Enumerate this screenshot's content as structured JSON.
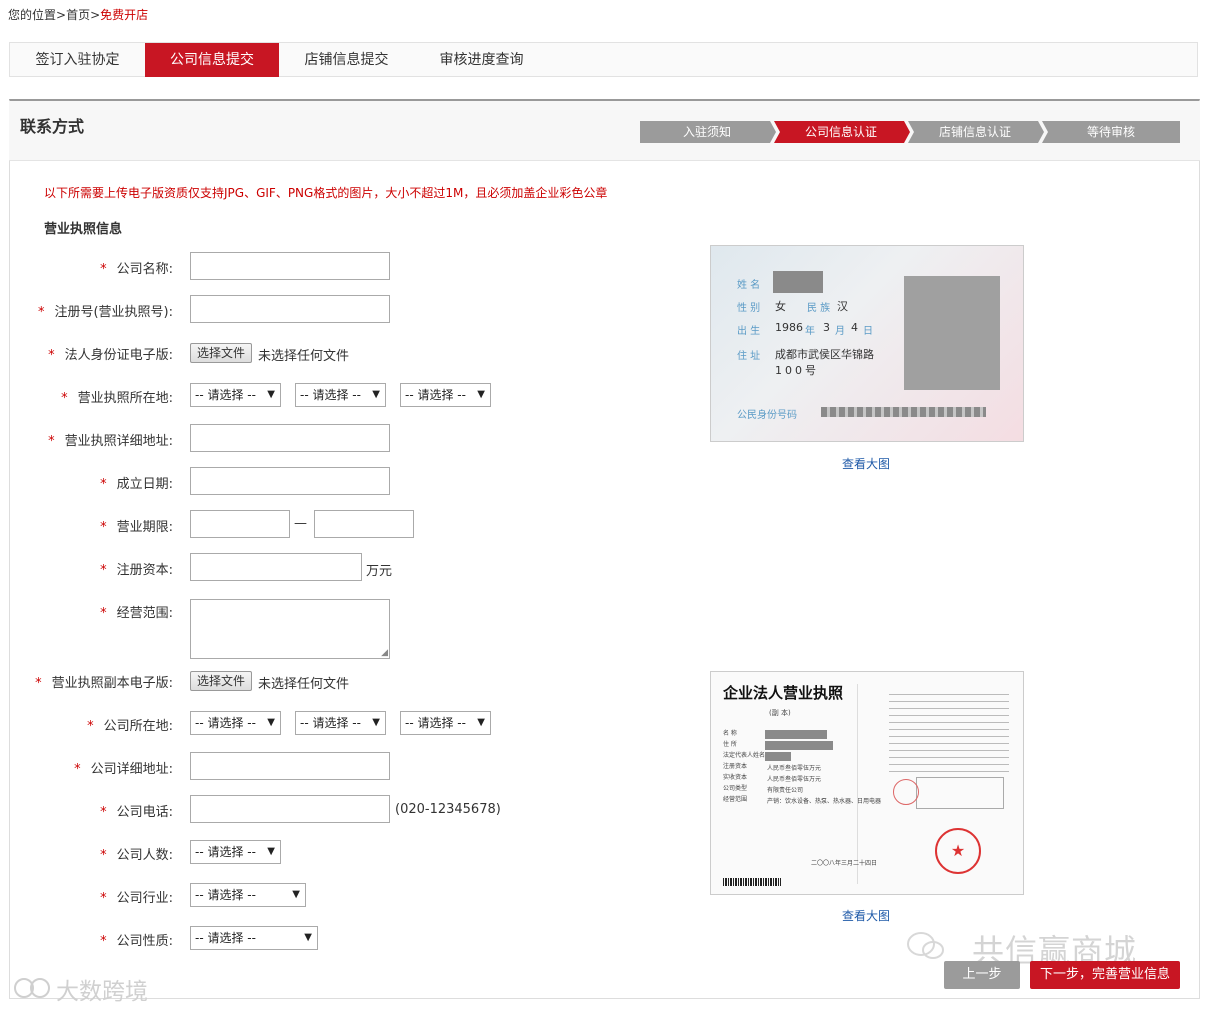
{
  "breadcrumb": {
    "prefix": "您的位置>",
    "home": "首页",
    "sep": ">",
    "current": "免费开店"
  },
  "tabs": [
    {
      "label": "签订入驻协定",
      "active": false
    },
    {
      "label": "公司信息提交",
      "active": true
    },
    {
      "label": "店铺信息提交",
      "active": false
    },
    {
      "label": "审核进度查询",
      "active": false
    }
  ],
  "panel": {
    "title": "联系方式"
  },
  "steps": [
    {
      "label": "入驻须知",
      "active": false
    },
    {
      "label": "公司信息认证",
      "active": true
    },
    {
      "label": "店铺信息认证",
      "active": false
    },
    {
      "label": "等待审核",
      "active": false
    }
  ],
  "notice": "以下所需要上传电子版资质仅支持JPG、GIF、PNG格式的图片，大小不超过1M，且必须加盖企业彩色公章",
  "section_title": "营业执照信息",
  "required_mark": "*",
  "fields": {
    "company_name": "公司名称:",
    "reg_no": "注册号(营业执照号):",
    "id_card": "法人身份证电子版:",
    "license_location": "营业执照所在地:",
    "license_address": "营业执照详细地址:",
    "founded": "成立日期:",
    "term": "营业期限:",
    "capital": "注册资本:",
    "scope": "经营范围:",
    "license_copy": "营业执照副本电子版:",
    "company_location": "公司所在地:",
    "company_address": "公司详细地址:",
    "phone": "公司电话:",
    "headcount": "公司人数:",
    "industry": "公司行业:",
    "nature": "公司性质:"
  },
  "file_button": "选择文件",
  "file_none": "未选择任何文件",
  "select_placeholder": "-- 请选择 --",
  "term_sep": "—",
  "capital_unit": "万元",
  "phone_hint": "(020-12345678)",
  "id_sample": {
    "name_label": "姓 名",
    "gender_label": "性 别",
    "gender": "女",
    "ethnic_label": "民 族",
    "ethnic": "汉",
    "birth_label": "出 生",
    "year": "1986",
    "year_u": "年",
    "month": "3",
    "month_u": "月",
    "day": "4",
    "day_u": "日",
    "addr_label": "住 址",
    "addr1": "成都市武侯区华锦路",
    "addr2": "100号",
    "idno_label": "公民身份号码"
  },
  "license_sample": {
    "title": "企业法人营业执照",
    "sub": "(副 本)",
    "rows": [
      "名 称",
      "住 所",
      "法定代表人姓名",
      "注册资本",
      "实收资本",
      "公司类型",
      "经营范围"
    ],
    "capital": "人民币叁佰零伍万元",
    "paid": "人民币叁佰零伍万元",
    "type": "有限责任公司",
    "scope": "产销：饮水设备、热泵、热水器、日用电器",
    "date": "二〇〇八年三月二十四日"
  },
  "view_large": "查看大图",
  "buttons": {
    "prev": "上一步",
    "next": "下一步，完善营业信息"
  },
  "watermarks": {
    "right": "共信赢商城",
    "left": "大数跨境"
  },
  "colors": {
    "accent": "#c81623",
    "step_gray": "#9b9b9b",
    "link": "#1f5aa8"
  }
}
